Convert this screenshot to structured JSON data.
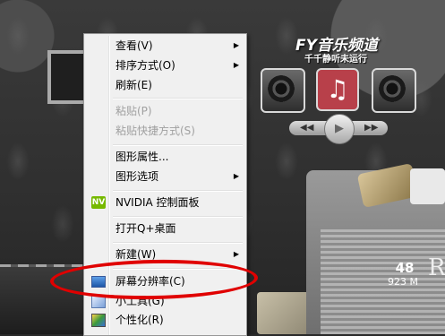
{
  "desktop": {
    "music_widget": {
      "title": "FY音乐频道",
      "subtitle": "千千静听未运行",
      "note_icon": "music-note-icon",
      "prev": "◀◀",
      "play": "▶",
      "next": "▶▶"
    },
    "stat_widget": {
      "value": "48",
      "memory": "923 M",
      "extra": "R"
    }
  },
  "context_menu": {
    "items": [
      {
        "label": "查看(V)",
        "submenu": true,
        "disabled": false
      },
      {
        "label": "排序方式(O)",
        "submenu": true,
        "disabled": false
      },
      {
        "label": "刷新(E)",
        "submenu": false,
        "disabled": false
      },
      {
        "label": "粘贴(P)",
        "submenu": false,
        "disabled": true
      },
      {
        "label": "粘贴快捷方式(S)",
        "submenu": false,
        "disabled": true
      },
      {
        "label": "图形属性...",
        "submenu": false,
        "disabled": false
      },
      {
        "label": "图形选项",
        "submenu": true,
        "disabled": false
      },
      {
        "label": "NVIDIA 控制面板",
        "submenu": false,
        "disabled": false,
        "icon": "nvidia-icon"
      },
      {
        "label": "打开Q+桌面",
        "submenu": false,
        "disabled": false
      },
      {
        "label": "新建(W)",
        "submenu": true,
        "disabled": false
      },
      {
        "label": "屏幕分辨率(C)",
        "submenu": false,
        "disabled": false,
        "icon": "monitor-icon"
      },
      {
        "label": "小工具(G)",
        "submenu": false,
        "disabled": false,
        "icon": "gadget-icon"
      },
      {
        "label": "个性化(R)",
        "submenu": false,
        "disabled": false,
        "icon": "personalize-icon"
      }
    ],
    "nvidia_icon_text": "NV"
  },
  "annotation": {
    "color": "#e00000",
    "highlighted_item": "屏幕分辨率(C)"
  }
}
